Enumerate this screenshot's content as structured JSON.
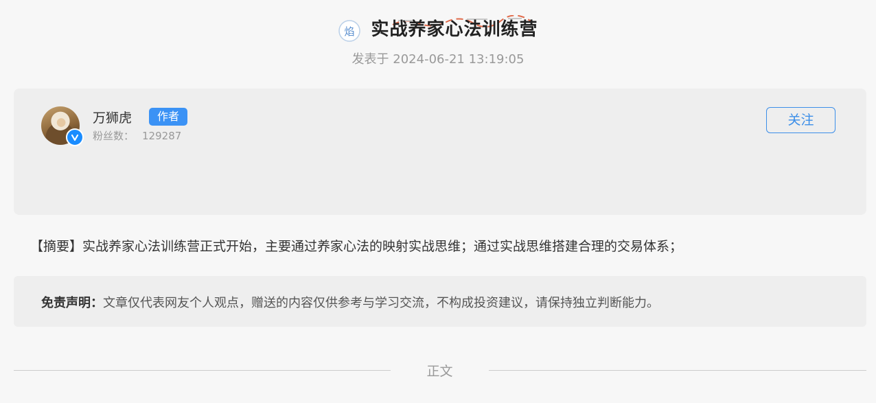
{
  "header": {
    "title": "实战养家心法训练营",
    "post_date": "发表于 2024-06-21 13:19:05",
    "badge_icon": "hot-badge-icon"
  },
  "author": {
    "name": "万狮虎",
    "tag": "作者",
    "fans_label": "粉丝数：",
    "fans_count": "129287",
    "follow_label": "关注",
    "verified_icon": "verified-icon"
  },
  "summary": {
    "text": "【摘要】实战养家心法训练营正式开始，主要通过养家心法的映射实战思维；通过实战思维搭建合理的交易体系；"
  },
  "disclaimer": {
    "label": "免责声明：",
    "text": "文章仅代表网友个人观点，赠送的内容仅供参考与学习交流，不构成投资建议，请保持独立判断能力。"
  },
  "section": {
    "label": "正文"
  },
  "colors": {
    "accent": "#3b92f5",
    "page_bg": "#f7f7f7",
    "card_bg": "#eeeeee"
  }
}
